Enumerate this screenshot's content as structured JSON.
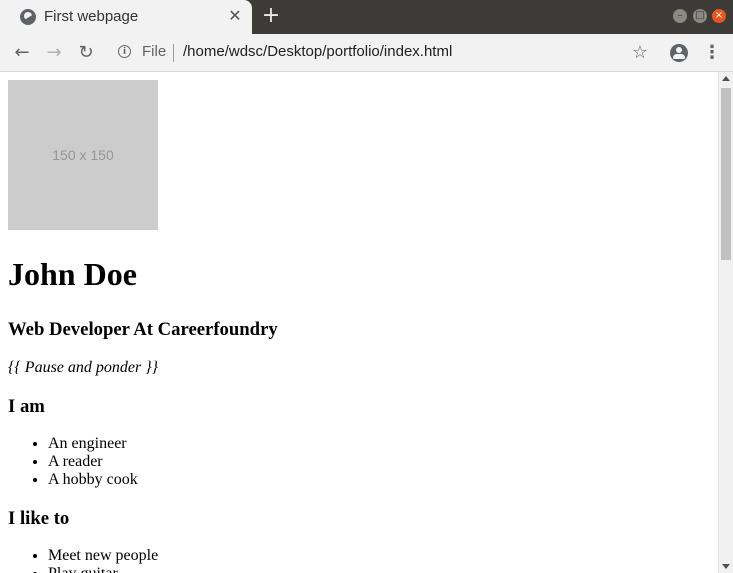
{
  "browser": {
    "tab_title": "First webpage",
    "scheme_label": "File",
    "url": "/home/wdsc/Desktop/portfolio/index.html",
    "new_tab_glyph": "+",
    "tab_close_glyph": "✕",
    "icons": [
      "globe-icon",
      "close-icon",
      "plus-icon",
      "back-arrow-icon",
      "forward-arrow-icon",
      "reload-icon",
      "info-icon",
      "star-icon",
      "account-icon",
      "kebab-menu-icon",
      "minimize-icon",
      "maximize-icon",
      "window-close-icon"
    ]
  },
  "page": {
    "image_placeholder": "150 x 150",
    "name": "John Doe",
    "role": "Web Developer At Careerfoundry",
    "quote": "{{ Pause and ponder }}",
    "i_am_heading": "I am",
    "i_am_items": [
      "An engineer",
      "A reader",
      "A hobby cook"
    ],
    "i_like_heading": "I like to",
    "i_like_items": [
      "Meet new people",
      "Play guitar"
    ]
  },
  "colors": {
    "titlebar": "#3c3b37",
    "tab": "#f2f2f2",
    "close_button": "#e95420",
    "placeholder_bg": "#cccccc",
    "placeholder_text": "#969696"
  }
}
